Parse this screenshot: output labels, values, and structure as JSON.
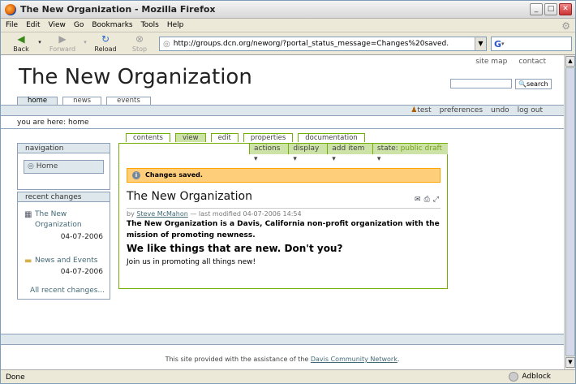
{
  "window": {
    "title": "The New Organization - Mozilla Firefox"
  },
  "menubar": {
    "items": [
      "File",
      "Edit",
      "View",
      "Go",
      "Bookmarks",
      "Tools",
      "Help"
    ]
  },
  "toolbar": {
    "back": "Back",
    "forward": "Forward",
    "reload": "Reload",
    "stop": "Stop"
  },
  "urlbar": {
    "value": "http://groups.dcn.org/neworg/?portal_status_message=Changes%20saved."
  },
  "site": {
    "toplinks": [
      "site map",
      "contact"
    ],
    "logo": "The New Organization",
    "search_button": "search",
    "tabs": [
      "home",
      "news",
      "events"
    ],
    "personal": {
      "user": "test",
      "preferences": "preferences",
      "undo": "undo",
      "logout": "log out"
    },
    "breadcrumb": "you are here: home"
  },
  "navigation": {
    "header": "navigation",
    "home": "Home"
  },
  "recent": {
    "header": "recent changes",
    "items": [
      {
        "title_line1": "The New",
        "title_line2": "Organization",
        "date": "04-07-2006"
      },
      {
        "title": "News and Events",
        "date": "04-07-2006"
      }
    ],
    "all": "All recent changes..."
  },
  "content_tabs": [
    "contents",
    "view",
    "edit",
    "properties",
    "documentation"
  ],
  "actions": {
    "actions": "actions",
    "display": "display",
    "add_item": "add item",
    "state_label": "state:",
    "state_value": "public draft"
  },
  "status_message": "Changes saved.",
  "document": {
    "title": "The New Organization",
    "by": "by",
    "author": "Steve McMahon",
    "modified": "— last modified 04-07-2006 14:54",
    "description": "The New Organization is a Davis, California non-profit organization with the mission of promoting newness.",
    "heading": "We like things that are new. Don't you?",
    "body": "Join us in promoting all things new!"
  },
  "footer": {
    "text": "This site provided with the assistance of the",
    "link": "Davis Community Network",
    "period": "."
  },
  "statusbar": {
    "status": "Done",
    "adblock": "Adblock"
  }
}
